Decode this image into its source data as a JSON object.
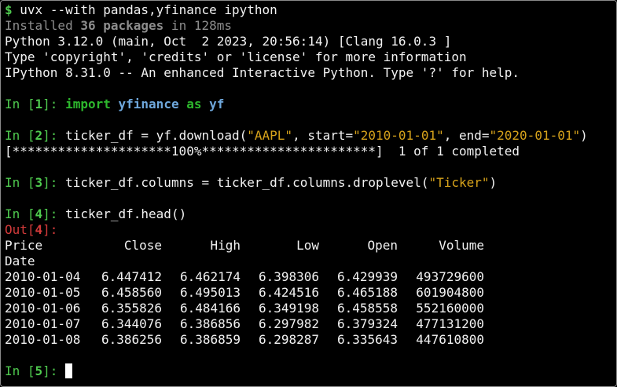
{
  "shell": {
    "prompt": "$",
    "command": "uvx --with pandas,yfinance ipython",
    "installed_prefix": "Installed ",
    "installed_count": "36 packages",
    "installed_suffix": " in 128ms"
  },
  "banner": [
    "Python 3.12.0 (main, Oct  2 2023, 20:56:14) [Clang 16.0.3 ]",
    "Type 'copyright', 'credits' or 'license' for more information",
    "IPython 8.31.0 -- An enhanced Interactive Python. Type '?' for help."
  ],
  "cells": {
    "c1": {
      "in_label": "In [",
      "num": "1",
      "close": "]: ",
      "kw_import": "import",
      "module": "yfinance",
      "kw_as": "as",
      "alias": "yf"
    },
    "c2": {
      "in_label": "In [",
      "num": "2",
      "close": "]: ",
      "code_a": "ticker_df = yf.download(",
      "str_ticker": "\"AAPL\"",
      "code_b": ", start=",
      "str_start": "\"2010-01-01\"",
      "code_c": ", end=",
      "str_end": "\"2020-01-01\"",
      "code_d": ")",
      "progress": "[*********************100%***********************]  1 of 1 completed"
    },
    "c3": {
      "in_label": "In [",
      "num": "3",
      "close": "]: ",
      "code_a": "ticker_df.columns = ticker_df.columns.droplevel(",
      "str_arg": "\"Ticker\"",
      "code_b": ")"
    },
    "c4": {
      "in_label": "In [",
      "num": "4",
      "close": "]: ",
      "code": "ticker_df.head()",
      "out_label": "Out[",
      "out_num": "4",
      "out_close": "]:"
    },
    "c5": {
      "in_label": "In [",
      "num": "5",
      "close": "]: "
    }
  },
  "table": {
    "header_first": "Price",
    "columns": [
      "Close",
      "High",
      "Low",
      "Open",
      "Volume"
    ],
    "index_name": "Date",
    "rows": [
      [
        "2010-01-04",
        "6.447412",
        "6.462174",
        "6.398306",
        "6.429939",
        "493729600"
      ],
      [
        "2010-01-05",
        "6.458560",
        "6.495013",
        "6.424516",
        "6.465188",
        "601904800"
      ],
      [
        "2010-01-06",
        "6.355826",
        "6.484166",
        "6.349198",
        "6.458558",
        "552160000"
      ],
      [
        "2010-01-07",
        "6.344076",
        "6.386856",
        "6.297982",
        "6.379324",
        "477131200"
      ],
      [
        "2010-01-08",
        "6.386256",
        "6.386859",
        "6.298287",
        "6.335643",
        "447610800"
      ]
    ]
  }
}
